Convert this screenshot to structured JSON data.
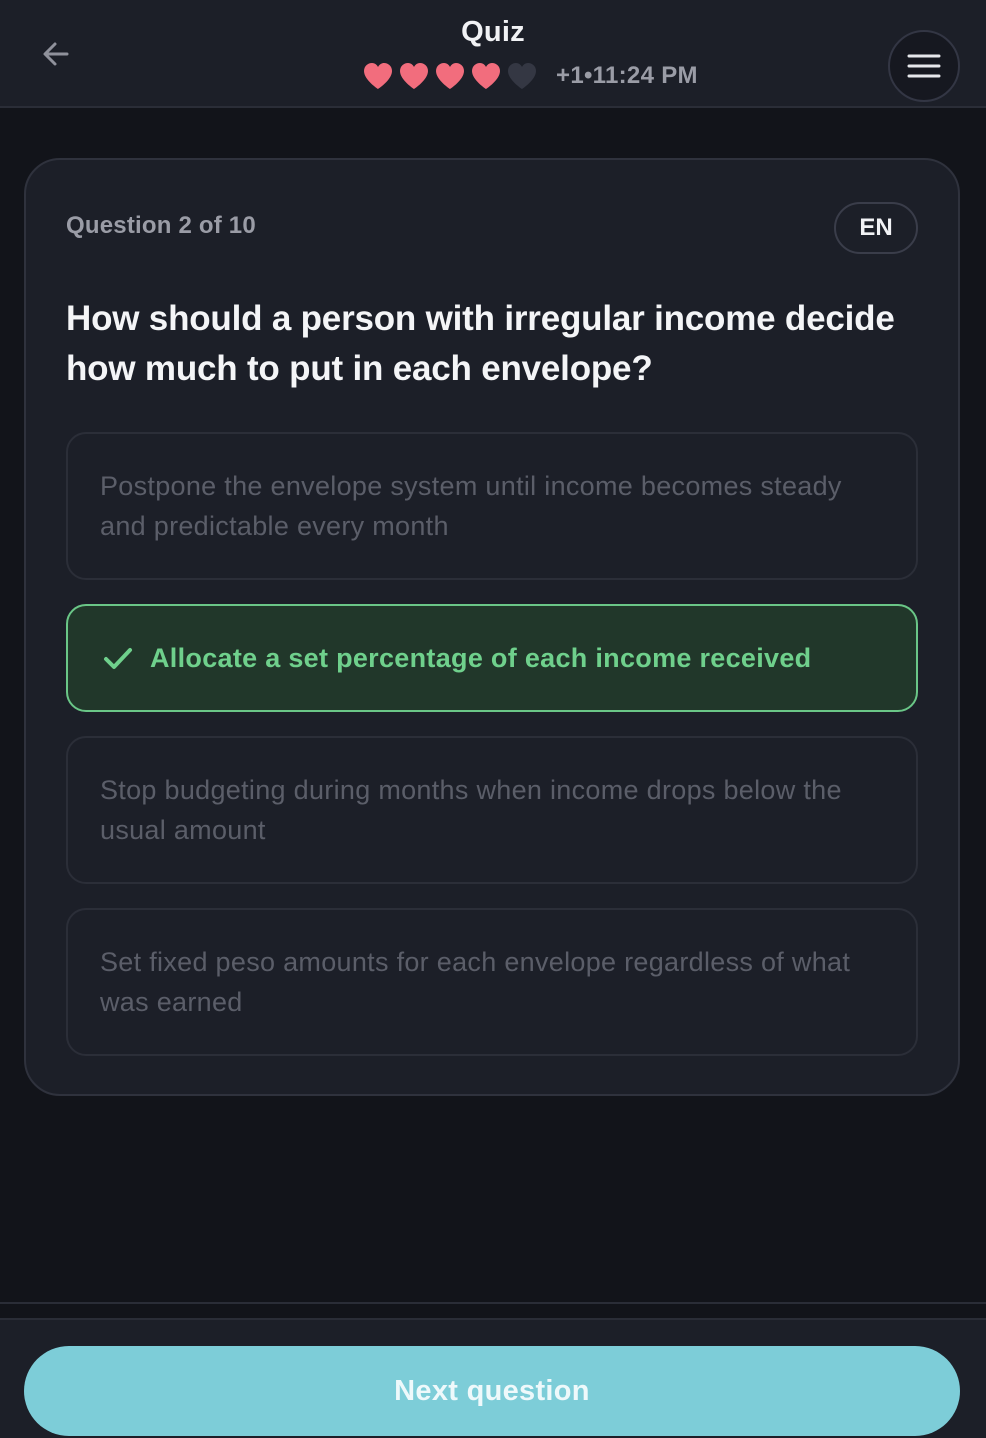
{
  "header": {
    "title": "Quiz",
    "back_icon": "arrow-left-icon",
    "menu_icon": "hamburger-menu-icon",
    "lives": {
      "total": 5,
      "remaining": 4,
      "full_color": "#f26d7d",
      "empty_color": "#343743"
    },
    "status_text": "+1•11:24 PM"
  },
  "card": {
    "counter": "Question 2 of 10",
    "language": "EN",
    "question": "How should a person with irregular income decide how much to put in each envelope?",
    "options": [
      {
        "label": "Postpone the envelope system until income becomes steady and predictable every month",
        "state": "disabled"
      },
      {
        "label": "Allocate a set percentage of each income received",
        "state": "correct",
        "icon": "check-icon"
      },
      {
        "label": "Stop budgeting during months when income drops below the usual amount",
        "state": "disabled"
      },
      {
        "label": "Set fixed peso amounts for each envelope regardless of what was earned",
        "state": "disabled"
      }
    ]
  },
  "footer": {
    "next_label": "Next question"
  },
  "colors": {
    "background": "#12141a",
    "surface": "#1c1f28",
    "correct_green": "#6fd08c",
    "correct_bg": "#21372a",
    "accent_teal": "#7dcdd8"
  }
}
